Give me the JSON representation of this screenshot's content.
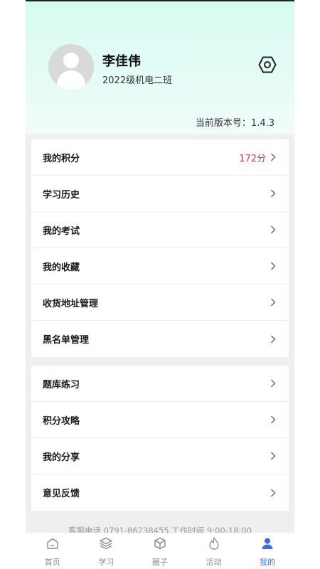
{
  "profile": {
    "name": "李佳伟",
    "class": "2022级机电二班",
    "version": "当前版本号：1.4.3"
  },
  "menu_group_1": [
    {
      "label": "我的积分",
      "value": "172分"
    },
    {
      "label": "学习历史",
      "value": ""
    },
    {
      "label": "我的考试",
      "value": ""
    },
    {
      "label": "我的收藏",
      "value": ""
    },
    {
      "label": "收货地址管理",
      "value": ""
    },
    {
      "label": "黑名单管理",
      "value": ""
    }
  ],
  "menu_group_2": [
    {
      "label": "题库练习"
    },
    {
      "label": "积分攻略"
    },
    {
      "label": "我的分享"
    },
    {
      "label": "意见反馈"
    }
  ],
  "footer": {
    "service": "客服电话 0791-86238455 工作时间 9:00-18:00"
  },
  "tabbar": {
    "active": "我的",
    "items": [
      {
        "label": "首页",
        "icon": "home-icon"
      },
      {
        "label": "学习",
        "icon": "layers-icon"
      },
      {
        "label": "圈子",
        "icon": "cube-icon"
      },
      {
        "label": "活动",
        "icon": "flame-icon"
      },
      {
        "label": "我的",
        "icon": "user-icon"
      }
    ]
  },
  "colors": {
    "accent": "#3a6fe0",
    "points": "#c8424b",
    "header_top": "#d6fbf1"
  }
}
